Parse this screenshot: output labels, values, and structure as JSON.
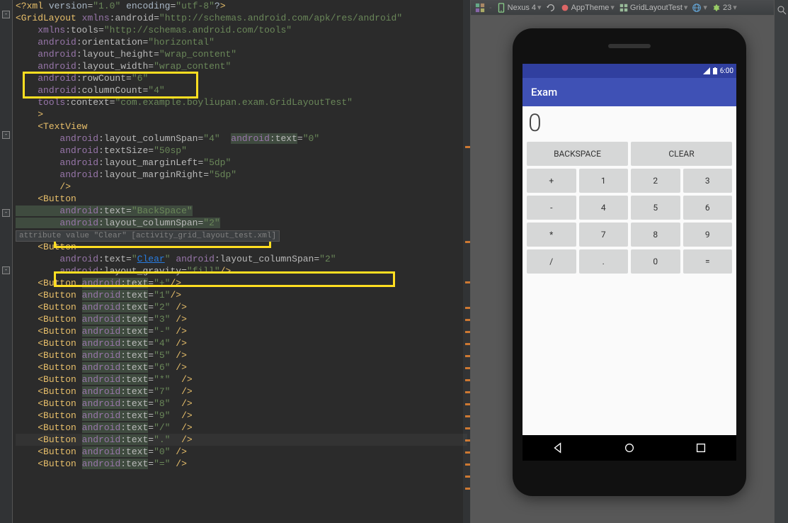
{
  "editor": {
    "lines": [
      "<?xml version=\"1.0\" encoding=\"utf-8\"?>",
      "<GridLayout xmlns:android=\"http://schemas.android.com/apk/res/android\"",
      "    xmlns:tools=\"http://schemas.android.com/tools\"",
      "    android:orientation=\"horizontal\"",
      "    android:layout_height=\"wrap_content\"",
      "    android:layout_width=\"wrap_content\"",
      "    android:rowCount=\"6\"",
      "    android:columnCount=\"4\"",
      "    tools:context=\"com.example.boyliupan.exam.GridLayoutTest\"",
      "    >",
      "    <TextView",
      "        android:layout_columnSpan=\"4\"  android:text=\"0\"",
      "        android:textSize=\"50sp\"",
      "        android:layout_marginLeft=\"5dp\"",
      "        android:layout_marginRight=\"5dp\"",
      "        />",
      "    <Button",
      "        android:text=\"BackSpace\"",
      "        android:layout_columnSpan=\"2\"",
      "attribute value \"Clear\" [activity_grid_layout_test.xml]",
      "    <Button",
      "        android:text=\"Clear\" android:layout_columnSpan=\"2\"",
      "        android:layout_gravity=\"fill\"/>",
      "    <Button android:text=\"+\"/>",
      "    <Button android:text=\"1\"/>",
      "    <Button android:text=\"2\" />",
      "    <Button android:text=\"3\" />",
      "    <Button android:text=\"-\" />",
      "    <Button android:text=\"4\" />",
      "    <Button android:text=\"5\" />",
      "    <Button android:text=\"6\" />",
      "    <Button android:text=\"*\"  />",
      "    <Button android:text=\"7\"  />",
      "    <Button android:text=\"8\"  />",
      "    <Button android:text=\"9\"  />",
      "    <Button android:text=\"/\"  />",
      "    <Button android:text=\".\"  />",
      "    <Button android:text=\"0\" />",
      "    <Button android:text=\"=\" />"
    ],
    "tooltip": "attribute value \"Clear\" [activity_grid_layout_test.xml]"
  },
  "toolbar": {
    "device": "Nexus 4",
    "theme": "AppTheme",
    "activity": "GridLayoutTest",
    "api": "23"
  },
  "phone": {
    "status_time": "6:00",
    "app_title": "Exam",
    "display_value": "0",
    "buttons_row1": [
      "BACKSPACE",
      "CLEAR"
    ],
    "buttons_grid": [
      [
        "+",
        "1",
        "2",
        "3"
      ],
      [
        "-",
        "4",
        "5",
        "6"
      ],
      [
        "*",
        "7",
        "8",
        "9"
      ],
      [
        "/",
        ".",
        "0",
        "="
      ]
    ]
  }
}
